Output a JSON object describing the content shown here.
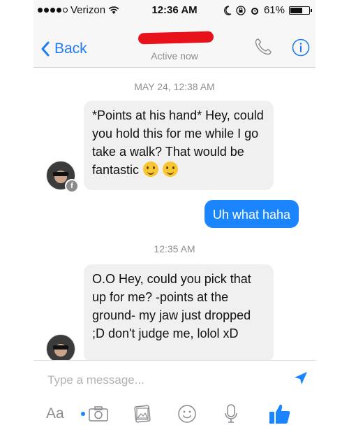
{
  "status_bar": {
    "carrier": "Verizon",
    "time": "12:36 AM",
    "battery": "61%",
    "battery_level": 0.61
  },
  "header": {
    "back_label": "Back",
    "subtitle": "Active now"
  },
  "messages": [
    {
      "type": "timestamp",
      "text": "MAY 24, 12:38 AM"
    },
    {
      "type": "incoming",
      "text": "*Points at his hand* Hey, could you hold this for me while I go take a walk? That would be fantastic",
      "emojis": [
        "wink-emoji",
        "smile-emoji"
      ]
    },
    {
      "type": "outgoing",
      "text": "Uh what haha"
    },
    {
      "type": "timestamp",
      "text": "12:35 AM"
    },
    {
      "type": "incoming",
      "text": "O.O Hey, could you pick that up for me? -points at the ground- my jaw just dropped ;D don't judge me, lolol xD"
    }
  ],
  "composer": {
    "placeholder": "Type a message...",
    "font_toggle_label": "Aa"
  },
  "colors": {
    "accent": "#1a85ff",
    "incoming_bubble": "#f1f0f0",
    "redaction": "#e8121a"
  },
  "icons": [
    "signal-dots-icon",
    "wifi-icon",
    "moon-icon",
    "lock-rotation-icon",
    "alarm-icon",
    "battery-icon",
    "back-chevron-icon",
    "phone-icon",
    "info-icon",
    "send-icon",
    "camera-icon",
    "photos-icon",
    "emoji-icon",
    "microphone-icon",
    "like-icon"
  ]
}
